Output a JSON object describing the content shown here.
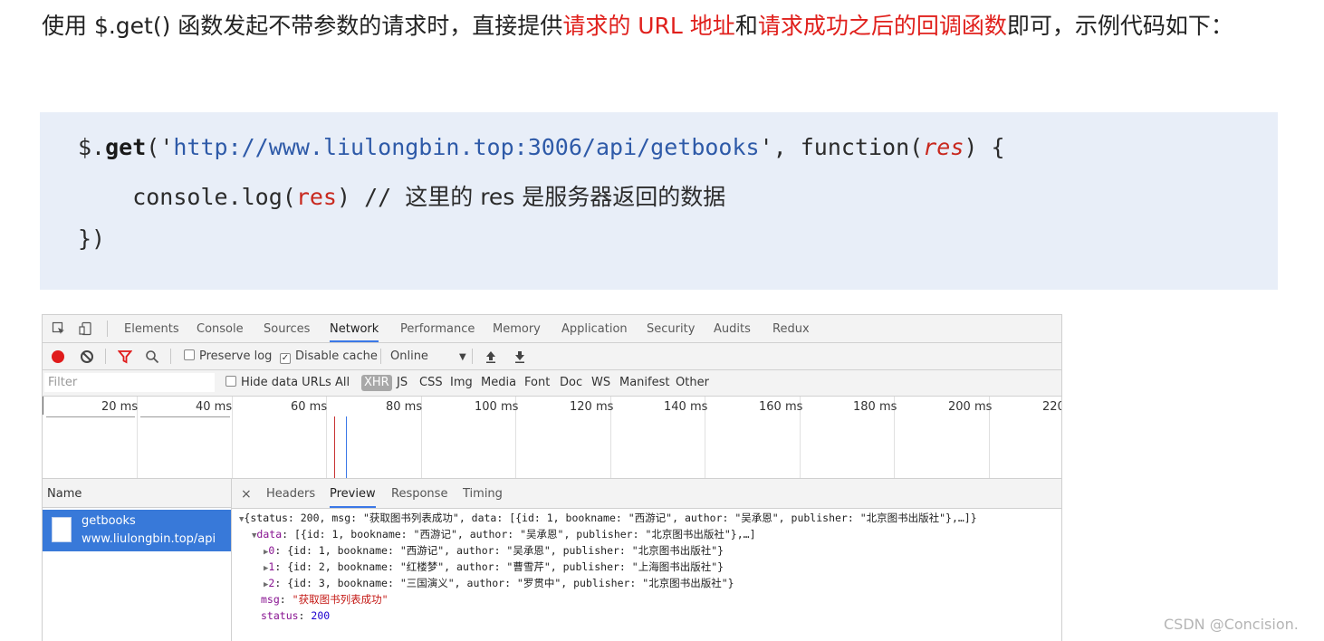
{
  "intro": {
    "part1": "使用 $.get() 函数发起不带参数的请求时，直接提供",
    "red1": "请求的 URL 地址",
    "part2": "和",
    "red2": "请求成功之后的回调函数",
    "part3": "即可，示例代码如下："
  },
  "code": {
    "l1_dollar": "$.",
    "l1_get": "get",
    "l1_open": "('",
    "l1_url": "http://www.liulongbin.top:3006/api/getbooks",
    "l1_mid": "', function(",
    "l1_arg": "res",
    "l1_end": ") {",
    "l2_pre": "    console.log(",
    "l2_arg": "res",
    "l2_post": ") // ",
    "l2_comment": "这里的 res 是服务器返回的数据",
    "l3": "})"
  },
  "devtools": {
    "tabs": [
      "Elements",
      "Console",
      "Sources",
      "Network",
      "Performance",
      "Memory",
      "Application",
      "Security",
      "Audits",
      "Redux"
    ],
    "active_tab": "Network",
    "toolbar": {
      "preserve_log": "Preserve log",
      "disable_cache": "Disable cache",
      "throttle": "Online",
      "preserve_checked": false,
      "disable_checked": true
    },
    "filter": {
      "placeholder": "Filter",
      "hide_data_urls": "Hide data URLs",
      "types": [
        "All",
        "XHR",
        "JS",
        "CSS",
        "Img",
        "Media",
        "Font",
        "Doc",
        "WS",
        "Manifest",
        "Other"
      ],
      "active_type": "XHR"
    },
    "timeline_ticks": [
      "20 ms",
      "40 ms",
      "60 ms",
      "80 ms",
      "100 ms",
      "120 ms",
      "140 ms",
      "160 ms",
      "180 ms",
      "200 ms",
      "220"
    ],
    "name_header": "Name",
    "request": {
      "name": "getbooks",
      "domain": "www.liulongbin.top/api"
    },
    "detail_tabs": [
      "Headers",
      "Preview",
      "Response",
      "Timing"
    ],
    "active_detail_tab": "Preview",
    "preview_lines": [
      {
        "indent": 0,
        "tri": "▼",
        "text": "{status: 200, msg: \"获取图书列表成功\", data: [{id: 1, bookname: \"西游记\", author: \"吴承恩\", publisher: \"北京图书出版社\"},…]}"
      },
      {
        "indent": 1,
        "tri": "▼",
        "key": "data",
        "text": ": [{id: 1, bookname: \"西游记\", author: \"吴承恩\", publisher: \"北京图书出版社\"},…]"
      },
      {
        "indent": 2,
        "tri": "▶",
        "key": "0",
        "text": ": {id: 1, bookname: \"西游记\", author: \"吴承恩\", publisher: \"北京图书出版社\"}"
      },
      {
        "indent": 2,
        "tri": "▶",
        "key": "1",
        "text": ": {id: 2, bookname: \"红楼梦\", author: \"曹雪芹\", publisher: \"上海图书出版社\"}"
      },
      {
        "indent": 2,
        "tri": "▶",
        "key": "2",
        "text": ": {id: 3, bookname: \"三国演义\", author: \"罗贯中\", publisher: \"北京图书出版社\"}"
      },
      {
        "indent": 1,
        "tri": "",
        "key": "msg",
        "sep": ": ",
        "strval": "\"获取图书列表成功\""
      },
      {
        "indent": 1,
        "tri": "",
        "key": "status",
        "sep": ": ",
        "numval": "200"
      }
    ]
  },
  "watermark": "CSDN @Concision."
}
